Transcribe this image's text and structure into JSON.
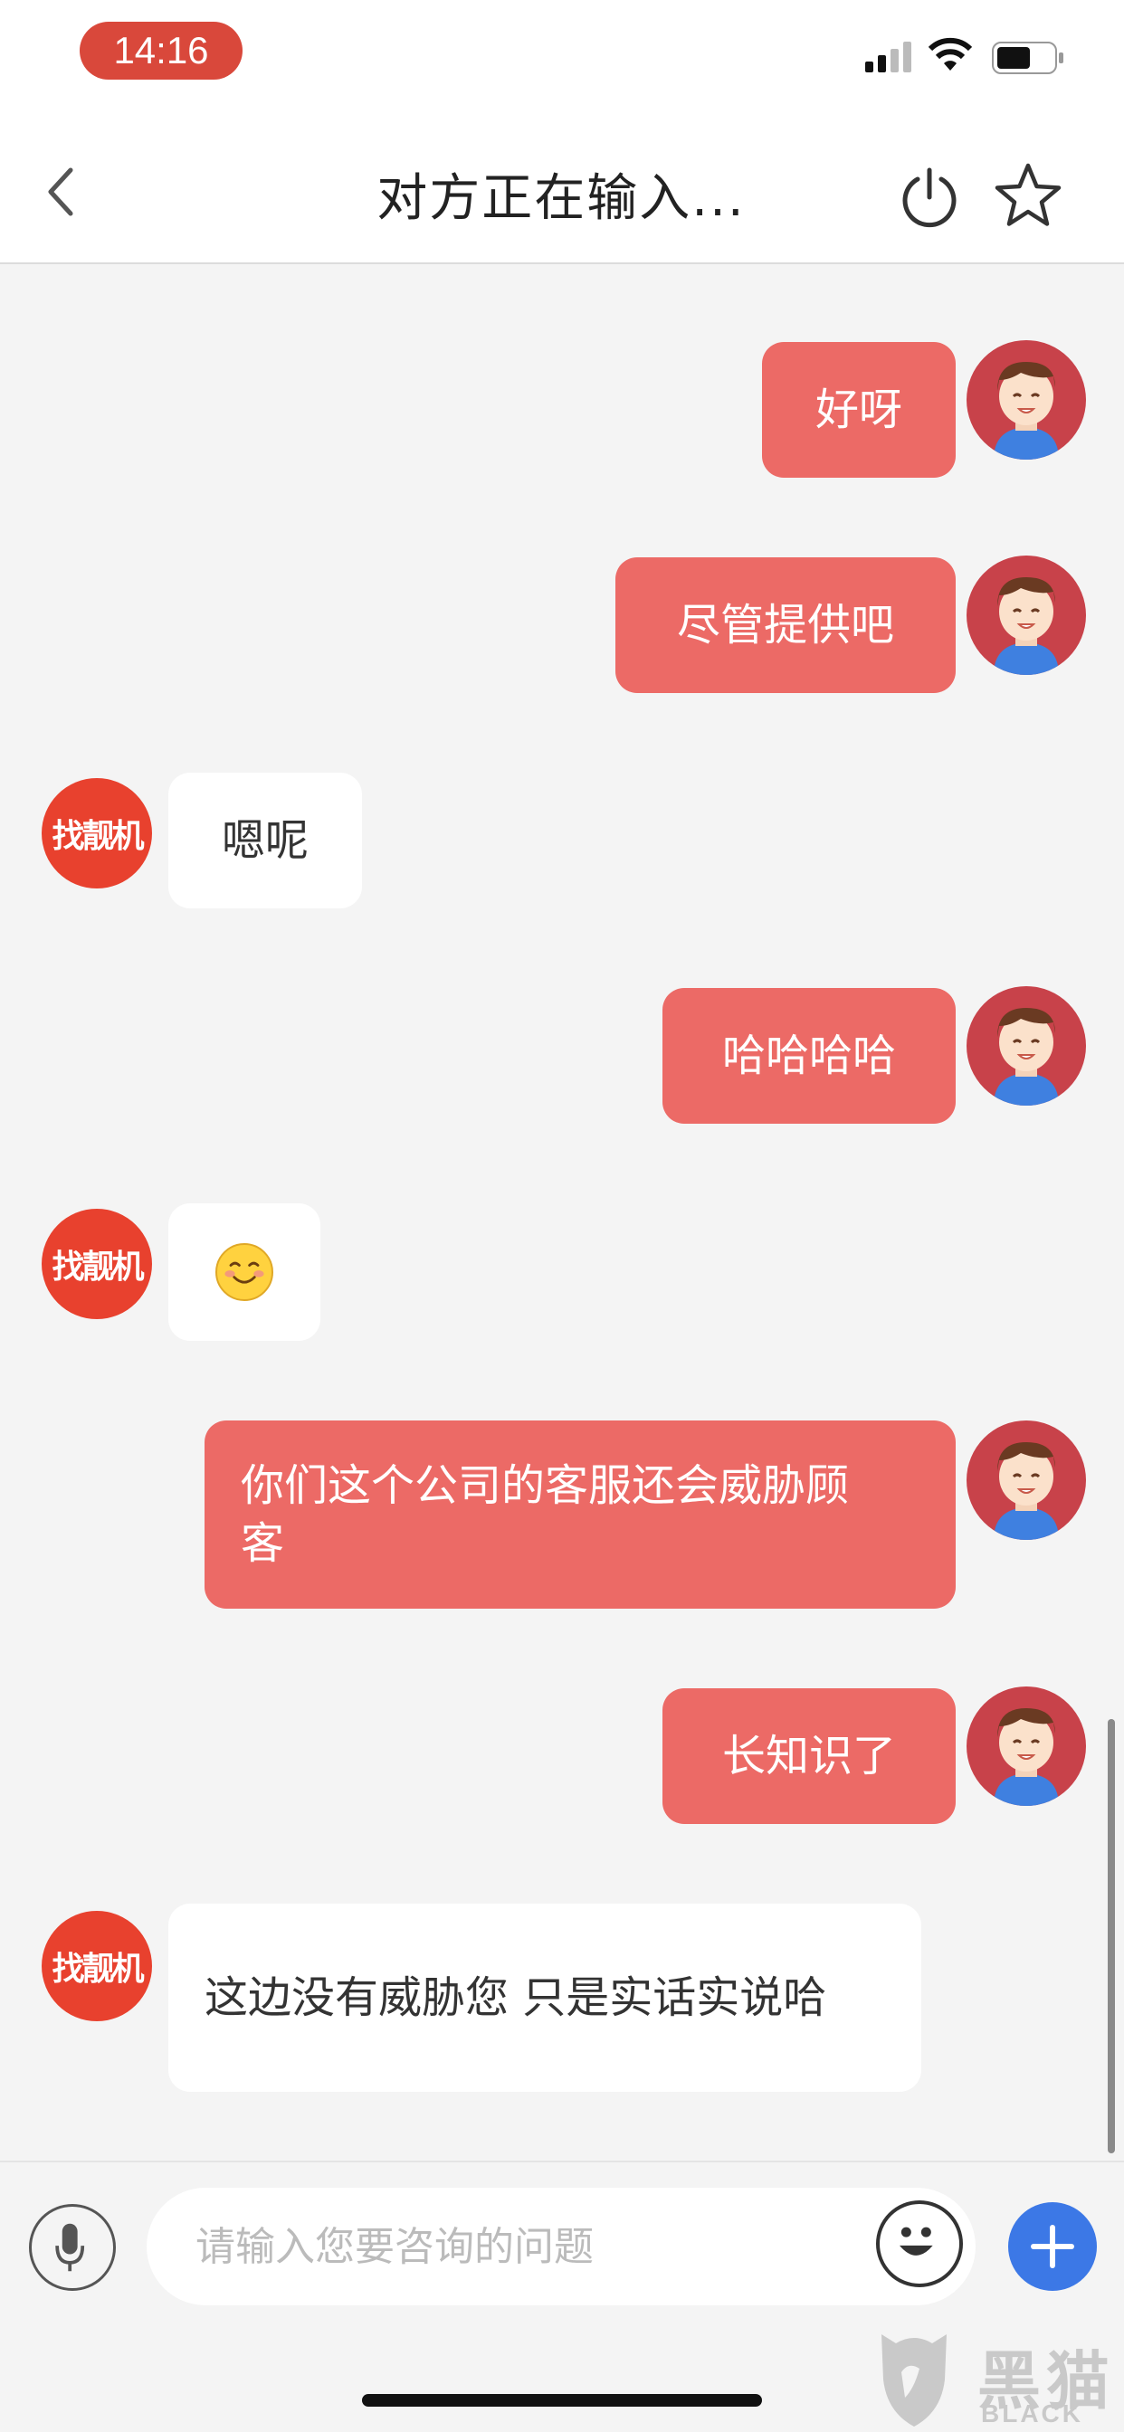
{
  "status_bar": {
    "time": "14:16"
  },
  "header": {
    "title": "对方正在输入..."
  },
  "messages": [
    {
      "sender": "me",
      "text": "好呀"
    },
    {
      "sender": "me",
      "text": "尽管提供吧"
    },
    {
      "sender": "them",
      "text": "嗯呢"
    },
    {
      "sender": "me",
      "text": "哈哈哈哈"
    },
    {
      "sender": "them",
      "text": "",
      "emoji": "smiling-face"
    },
    {
      "sender": "me",
      "text": "你们这个公司的客服还会威胁顾客"
    },
    {
      "sender": "me",
      "text": "长知识了"
    },
    {
      "sender": "them",
      "text": "这边没有威胁您 只是实话实说哈"
    }
  ],
  "agent": {
    "avatar_text": "找靓机"
  },
  "input": {
    "placeholder": "请输入您要咨询的问题"
  },
  "watermark": {
    "text": "黑猫",
    "sub": "BLACK CAT"
  },
  "colors": {
    "my_bubble": "#ec6a66",
    "brand_red": "#e8412e",
    "plus_blue": "#3c78e6"
  }
}
